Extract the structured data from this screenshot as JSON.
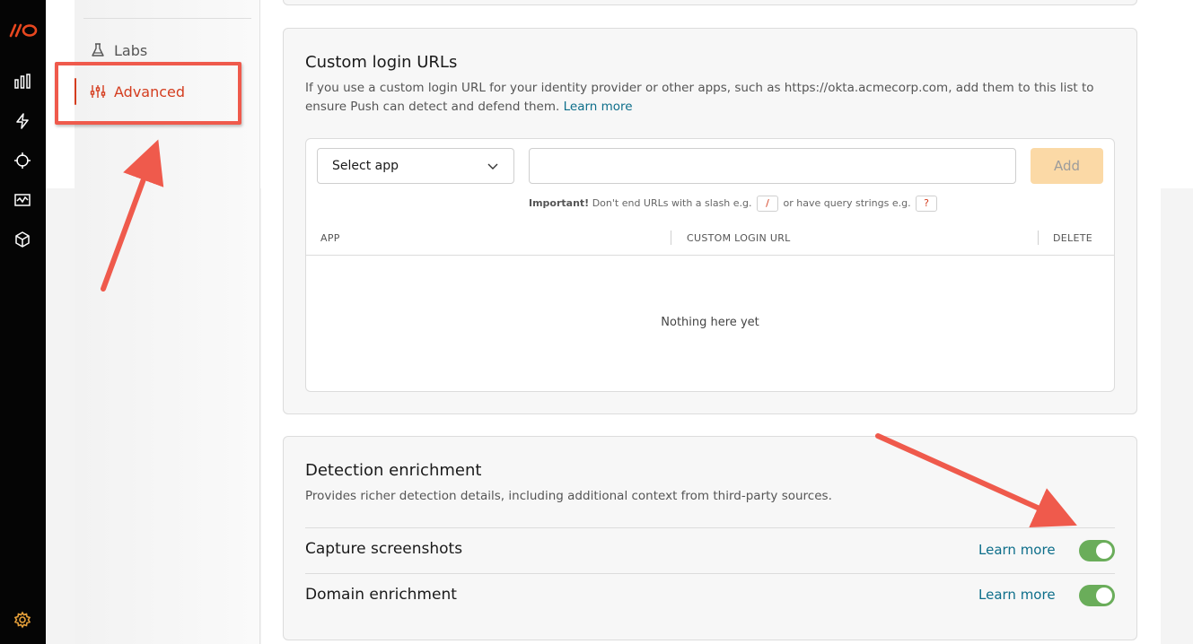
{
  "rail": {
    "logo": "//O",
    "icons": [
      "analytics-icon",
      "lightning-icon",
      "crosshair-icon",
      "monitor-icon",
      "cube-icon",
      "settings-gear-icon"
    ]
  },
  "sidenav": {
    "items": [
      {
        "label": "Labs",
        "icon": "flask-icon"
      },
      {
        "label": "Advanced",
        "icon": "sliders-icon",
        "active": true
      }
    ]
  },
  "custom_login": {
    "title": "Custom login URLs",
    "description": "If you use a custom login URL for your identity provider or other apps, such as https://okta.acmecorp.com, add them to this list to ensure Push can detect and defend them.",
    "learn_more": "Learn more",
    "select_app": "Select app",
    "url_value": "",
    "add_label": "Add",
    "hint": {
      "strong": "Important!",
      "part1": "Don't end URLs with a slash e.g.",
      "slash": "/",
      "part2": "or have query strings e.g.",
      "question": "?"
    },
    "columns": [
      "APP",
      "CUSTOM LOGIN URL",
      "DELETE"
    ],
    "empty_text": "Nothing here yet"
  },
  "detection": {
    "title": "Detection enrichment",
    "description": "Provides richer detection details, including additional context from third-party sources.",
    "rows": [
      {
        "label": "Capture screenshots",
        "link": "Learn more",
        "enabled": true
      },
      {
        "label": "Domain enrichment",
        "link": "Learn more",
        "enabled": true
      }
    ]
  },
  "colors": {
    "accent": "#d43d1f",
    "toggle_on": "#6aad5a",
    "link": "#0d6e8a",
    "add_disabled": "#fbd9a6",
    "annotation": "#ef5a4c"
  }
}
